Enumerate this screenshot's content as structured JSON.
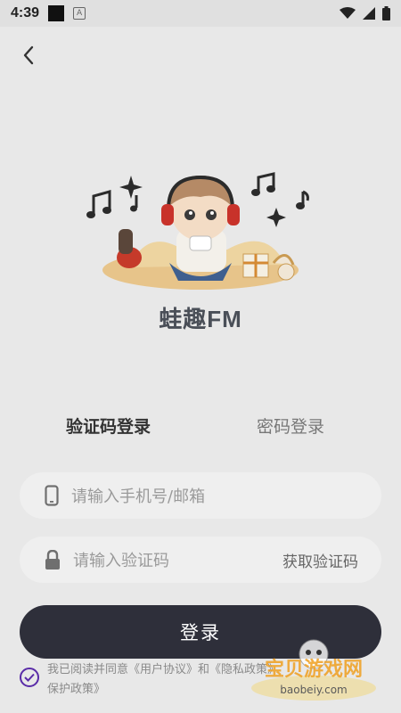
{
  "status": {
    "time": "4:39",
    "badge": "A"
  },
  "brand": {
    "name": "蛙趣FM"
  },
  "tabs": [
    {
      "label": "验证码登录",
      "active": true
    },
    {
      "label": "密码登录",
      "active": false
    }
  ],
  "form": {
    "phone_placeholder": "请输入手机号/邮箱",
    "code_placeholder": "请输入验证码",
    "get_code_label": "获取验证码",
    "login_label": "登录"
  },
  "agreement": {
    "prefix": "我已阅读并同意",
    "user_agreement": "《用户协议》",
    "and": "和",
    "privacy_policy": "《隐私政策》",
    "rest": "保护政策》",
    "checked": true,
    "check_color": "#5a2ca8"
  },
  "watermark": {
    "text": "宝贝游戏网",
    "url_text": "baobeiy.com"
  },
  "colors": {
    "background": "#e8e8e8",
    "button": "#2e2f3a",
    "accent": "#5a2ca8"
  }
}
